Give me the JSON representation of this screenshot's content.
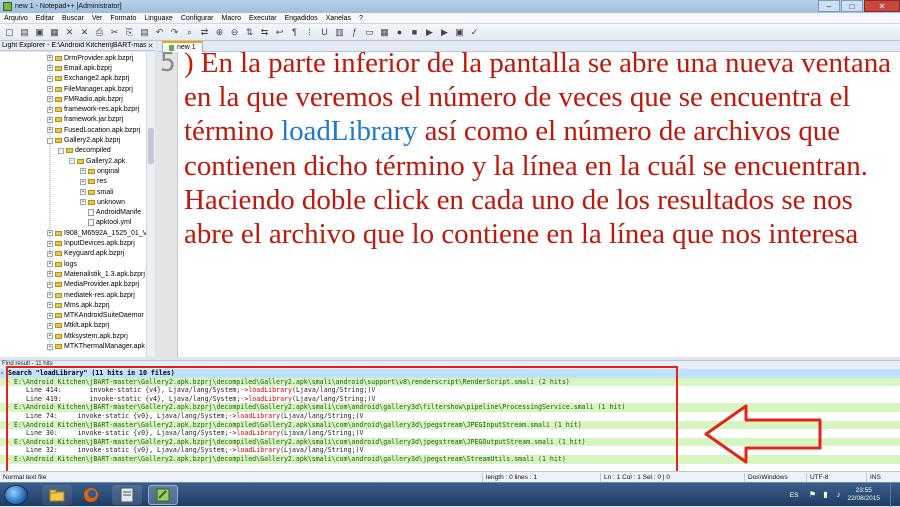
{
  "window": {
    "title": "new 1 - Notepad++ [Administrator]",
    "minimize": "–",
    "maximize": "□",
    "close": "✕"
  },
  "menu": [
    "Arquivo",
    "Editar",
    "Buscar",
    "Ver",
    "Formato",
    "Linguaxe",
    "Configurar",
    "Macro",
    "Executar",
    "Engadidos",
    "Xanelas",
    "?"
  ],
  "toolbar_icons": [
    "new-file-icon",
    "open-file-icon",
    "save-icon",
    "save-all-icon",
    "close-icon",
    "close-all-icon",
    "print-icon",
    "cut-icon",
    "copy-icon",
    "paste-icon",
    "undo-icon",
    "redo-icon",
    "find-icon",
    "replace-icon",
    "zoom-in-icon",
    "zoom-out-icon",
    "sync-v-icon",
    "sync-h-icon",
    "wrap-icon",
    "all-chars-icon",
    "indent-guide-icon",
    "udl-icon",
    "doc-map-icon",
    "function-list-icon",
    "folder-workspace-icon",
    "monitor-icon",
    "record-icon",
    "stop-icon",
    "play-icon",
    "play-multi-icon",
    "save-macro-icon",
    "spellcheck-icon"
  ],
  "explorer": {
    "title": "Light Explorer - E:\\Android Kitchen\\jBART-master\\G",
    "items": [
      {
        "label": "DrmProvider.apk.bzprj",
        "depth": 0,
        "type": "folder",
        "toggle": "+"
      },
      {
        "label": "Email.apk.bzprj",
        "depth": 0,
        "type": "folder",
        "toggle": "+"
      },
      {
        "label": "Exchange2.apk.bzprj",
        "depth": 0,
        "type": "folder",
        "toggle": "+"
      },
      {
        "label": "FileManager.apk.bzprj",
        "depth": 0,
        "type": "folder",
        "toggle": "+"
      },
      {
        "label": "FMRadio.apk.bzprj",
        "depth": 0,
        "type": "folder",
        "toggle": "+"
      },
      {
        "label": "framework-res.apk.bzprj",
        "depth": 0,
        "type": "folder",
        "toggle": "+"
      },
      {
        "label": "framework.jar.bzprj",
        "depth": 0,
        "type": "folder",
        "toggle": "+"
      },
      {
        "label": "FusedLocation.apk.bzprj",
        "depth": 0,
        "type": "folder",
        "toggle": "+"
      },
      {
        "label": "Gallery2.apk.bzprj",
        "depth": 0,
        "type": "folder",
        "toggle": "-"
      },
      {
        "label": "decompiled",
        "depth": 1,
        "type": "folder",
        "toggle": "-"
      },
      {
        "label": "Gallery2.apk",
        "depth": 2,
        "type": "folder",
        "toggle": "-"
      },
      {
        "label": "original",
        "depth": 3,
        "type": "folder",
        "toggle": "+"
      },
      {
        "label": "res",
        "depth": 3,
        "type": "folder",
        "toggle": "+"
      },
      {
        "label": "smali",
        "depth": 3,
        "type": "folder",
        "toggle": "+"
      },
      {
        "label": "unknown",
        "depth": 3,
        "type": "folder",
        "toggle": "+"
      },
      {
        "label": "AndroidManife",
        "depth": 3,
        "type": "file",
        "toggle": ""
      },
      {
        "label": "apktool.yml",
        "depth": 3,
        "type": "file",
        "toggle": ""
      },
      {
        "label": "I908_M6592A_1525_01_V31",
        "depth": 0,
        "type": "folder",
        "toggle": "+"
      },
      {
        "label": "InputDevices.apk.bzprj",
        "depth": 0,
        "type": "folder",
        "toggle": "+"
      },
      {
        "label": "Keyguard.apk.bzprj",
        "depth": 0,
        "type": "folder",
        "toggle": "+"
      },
      {
        "label": "logs",
        "depth": 0,
        "type": "folder",
        "toggle": "+"
      },
      {
        "label": "Materialistik_1.3.apk.bzprj",
        "depth": 0,
        "type": "folder",
        "toggle": "+"
      },
      {
        "label": "MediaProvider.apk.bzprj",
        "depth": 0,
        "type": "folder",
        "toggle": "+"
      },
      {
        "label": "mediatek-res.apk.bzprj",
        "depth": 0,
        "type": "folder",
        "toggle": "+"
      },
      {
        "label": "Mms.apk.bzprj",
        "depth": 0,
        "type": "folder",
        "toggle": "+"
      },
      {
        "label": "MTKAndroidSuiteDaemor",
        "depth": 0,
        "type": "folder",
        "toggle": "+"
      },
      {
        "label": "Mtklt.apk.bzprj",
        "depth": 0,
        "type": "folder",
        "toggle": "+"
      },
      {
        "label": "Mtksystem.apk.bzprj",
        "depth": 0,
        "type": "folder",
        "toggle": "+"
      },
      {
        "label": "MTKThermalManager.apk",
        "depth": 0,
        "type": "folder",
        "toggle": "+"
      }
    ]
  },
  "tab": {
    "label": "new 1"
  },
  "editor": {
    "line_number": "5",
    "text_before": ") En la parte inferior de la pantalla se abre una nueva ventana en la que veremos el número de veces que se encuentra el término ",
    "highlight": "loadLibrary",
    "text_after": " así como el número de archivos que contienen dicho término y la línea en la cuál se encuentran. Haciendo doble click en cada uno de los resultados se nos abre el archivo que lo contiene en la línea que nos interesa"
  },
  "find_panel": {
    "title": "Find result - 11 hits",
    "rows": [
      {
        "type": "search",
        "text": "Search \"loadLibrary\" (11 hits in 10 files)"
      },
      {
        "type": "file",
        "text": "E:\\Android Kitchen\\jBART-master\\Gallery2.apk.bzprj\\decompiled\\Gallery2.apk\\smali\\android\\support\\v8\\renderscript\\RenderScript.smali (2 hits)"
      },
      {
        "type": "line",
        "pre": "Line 414:       invoke-static {v4}, Ljava/lang/System;->",
        "kw": "loadLibrary",
        "post": "(Ljava/lang/String;)V"
      },
      {
        "type": "line",
        "pre": "Line 419:       invoke-static {v4}, Ljava/lang/System;->",
        "kw": "loadLibrary",
        "post": "(Ljava/lang/String;)V"
      },
      {
        "type": "file",
        "text": "E:\\Android Kitchen\\jBART-master\\Gallery2.apk.bzprj\\decompiled\\Gallery2.apk\\smali\\com\\android\\gallery3d\\filtershow\\pipeline\\ProcessingService.smali (1 hit)"
      },
      {
        "type": "line",
        "pre": "Line 74:     invoke-static {v0}, Ljava/lang/System;->",
        "kw": "loadLibrary",
        "post": "(Ljava/lang/String;)V"
      },
      {
        "type": "file",
        "text": "E:\\Android Kitchen\\jBART-master\\Gallery2.apk.bzprj\\decompiled\\Gallery2.apk\\smali\\com\\android\\gallery3d\\jpegstream\\JPEGInputStream.smali (1 hit)"
      },
      {
        "type": "line",
        "pre": "Line 30:     invoke-static {v0}, Ljava/lang/System;->",
        "kw": "loadLibrary",
        "post": "(Ljava/lang/String;)V"
      },
      {
        "type": "file",
        "text": "E:\\Android Kitchen\\jBART-master\\Gallery2.apk.bzprj\\decompiled\\Gallery2.apk\\smali\\com\\android\\gallery3d\\jpegstream\\JPEGOutputStream.smali (1 hit)"
      },
      {
        "type": "line",
        "pre": "Line 32:     invoke-static {v0}, Ljava/lang/System;->",
        "kw": "loadLibrary",
        "post": "(Ljava/lang/String;)V"
      },
      {
        "type": "file",
        "text": "E:\\Android Kitchen\\jBART-master\\Gallery2.apk.bzprj\\decompiled\\Gallery2.apk\\smali\\com\\android\\gallery3d\\jpegstream\\StreamUtils.smali (1 hit)"
      }
    ]
  },
  "statusbar": {
    "doc_type": "Normal text file",
    "length": "length : 0   lines : 1",
    "pos": "Ln : 1   Col : 1   Sel : 0 | 0",
    "eol": "Dos\\Windows",
    "encoding": "UTF-8",
    "mode": "INS"
  },
  "taskbar": {
    "lang": "ES",
    "time": "23:55",
    "date": "22/08/2015"
  },
  "colors": {
    "editor_text": "#c0180c",
    "highlight": "#1f78d1",
    "annotation": "#e2231a"
  }
}
